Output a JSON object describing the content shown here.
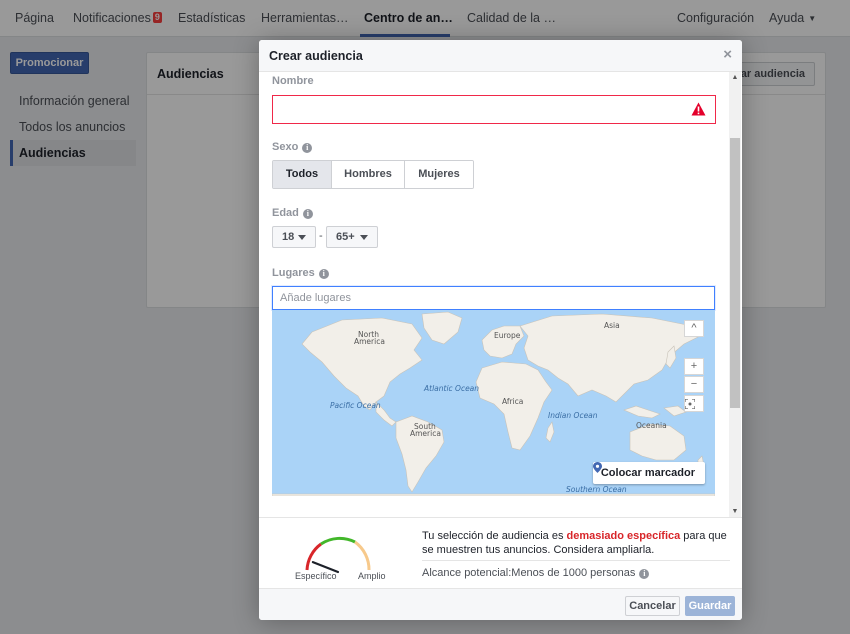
{
  "topnav": {
    "tabs": [
      {
        "label": "Página"
      },
      {
        "label": "Notificaciones",
        "badge": "9"
      },
      {
        "label": "Estadísticas"
      },
      {
        "label": "Herramientas…"
      },
      {
        "label": "Centro de an…",
        "active": true
      },
      {
        "label": "Calidad de la …"
      }
    ],
    "settings": "Configuración",
    "help": "Ayuda"
  },
  "left": {
    "promote": "Promocionar",
    "nav": [
      "Información general",
      "Todos los anuncios",
      "Audiencias"
    ],
    "selected": "Audiencias"
  },
  "content": {
    "title": "Audiencias",
    "create_button": "Crear audiencia"
  },
  "modal": {
    "title": "Crear audiencia",
    "close": "×",
    "name_label": "Nombre",
    "name_value": "",
    "gender_label": "Sexo",
    "gender_options": [
      "Todos",
      "Hombres",
      "Mujeres"
    ],
    "gender_selected": "Todos",
    "age_label": "Edad",
    "age_min": "18",
    "age_max": "65+",
    "age_dash": "-",
    "places_label": "Lugares",
    "places_placeholder": "Añade lugares",
    "map": {
      "labels": [
        "North America",
        "Europe",
        "Asia",
        "Atlantic Ocean",
        "Pacific Ocean",
        "Africa",
        "Indian Ocean",
        "South America",
        "Oceania",
        "Southern Ocean"
      ],
      "place_marker": "Colocar marcador",
      "controls": [
        "^",
        "+",
        "−"
      ]
    },
    "summary": {
      "text_before": "Tu selección de audiencia es ",
      "text_emph": "demasiado específica",
      "text_after": " para que se muestren tus anuncios. Considera ampliarla.",
      "reach": "Alcance potencial:Menos de 1000 personas",
      "gauge_left": "Específico",
      "gauge_right": "Amplio",
      "gauge_level": 0.12
    },
    "cancel": "Cancelar",
    "save": "Guardar"
  },
  "colors": {
    "accent": "#4267b2",
    "error": "#f02849",
    "map_water": "#aad3f7",
    "map_land": "#f2efe9"
  }
}
